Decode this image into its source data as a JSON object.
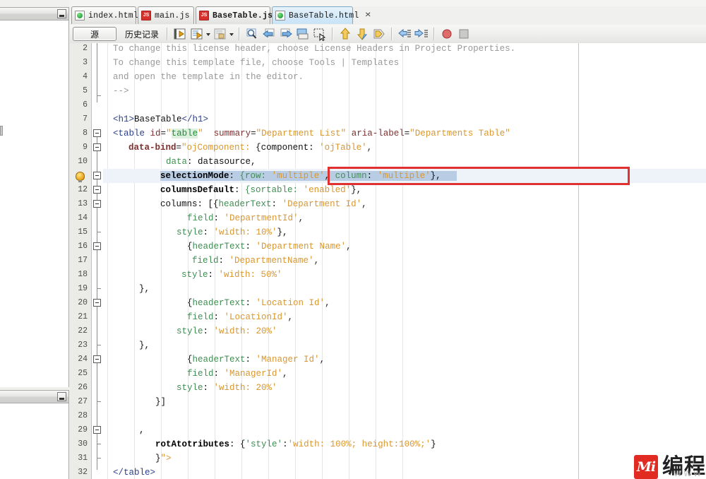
{
  "window": {
    "left_panels": [
      {
        "name": "upper-dock-panel",
        "minimize_label": "minimize"
      },
      {
        "name": "lower-dock-panel",
        "minimize_label": "minimize"
      }
    ]
  },
  "tabs": [
    {
      "label": "index.html",
      "icon": "html-file-icon",
      "active": false,
      "bold": false,
      "close": "✕"
    },
    {
      "label": "main.js",
      "icon": "js-file-icon",
      "active": false,
      "bold": false,
      "close": "✕"
    },
    {
      "label": "BaseTable.js",
      "icon": "js-file-icon",
      "active": false,
      "bold": true,
      "close": "✕"
    },
    {
      "label": "BaseTable.html",
      "icon": "html-file-icon",
      "active": true,
      "bold": false,
      "close": "✕"
    }
  ],
  "toolbar": {
    "source_label": "源",
    "history_label": "历史记录",
    "buttons": [
      "back-to-source-icon",
      "edit-with-dropdown-icon",
      "insert-icon",
      "find-icon",
      "previous-icon",
      "next-icon",
      "toggle-panel-icon",
      "select-region-icon",
      "shift-up-icon",
      "shift-down-icon",
      "tag-icon",
      "shift-left-icon",
      "shift-right-icon",
      "stop-record-icon",
      "stop-icon"
    ]
  },
  "editor": {
    "first_visible_line": 2,
    "last_visible_line": 32,
    "selected_line": 11,
    "bulb_line": 11,
    "lines": [
      {
        "n": 2,
        "indent": 1,
        "tokens": [
          {
            "t": "To change this license header, choose License Headers in Project Properties.",
            "c": "c-comment"
          }
        ]
      },
      {
        "n": 3,
        "indent": 1,
        "tokens": [
          {
            "t": "To change this template file, choose Tools | Templates",
            "c": "c-comment"
          }
        ]
      },
      {
        "n": 4,
        "indent": 1,
        "tokens": [
          {
            "t": "and open the template in the editor.",
            "c": "c-comment"
          }
        ]
      },
      {
        "n": 5,
        "indent": 1,
        "tokens": [
          {
            "t": "-->",
            "c": "c-comment"
          }
        ]
      },
      {
        "n": 6,
        "indent": 0,
        "tokens": []
      },
      {
        "n": 7,
        "indent": 1,
        "tokens": [
          {
            "t": "<h1>",
            "c": "c-tag"
          },
          {
            "t": "BaseTable",
            "c": "c-plain"
          },
          {
            "t": "</h1>",
            "c": "c-tag"
          }
        ]
      },
      {
        "n": 8,
        "indent": 1,
        "tokens": [
          {
            "t": "<table",
            "c": "c-tag"
          },
          {
            "t": " ",
            "c": "c-plain"
          },
          {
            "t": "id",
            "c": "c-attrplain"
          },
          {
            "t": "=",
            "c": "c-punct"
          },
          {
            "t": "\"",
            "c": "c-str"
          },
          {
            "t": "table",
            "c": "c-strhl"
          },
          {
            "t": "\"",
            "c": "c-str"
          },
          {
            "t": "  ",
            "c": "c-plain"
          },
          {
            "t": "summary",
            "c": "c-attrplain"
          },
          {
            "t": "=",
            "c": "c-punct"
          },
          {
            "t": "\"Department List\"",
            "c": "c-str"
          },
          {
            "t": " ",
            "c": "c-plain"
          },
          {
            "t": "aria-label",
            "c": "c-attrplain"
          },
          {
            "t": "=",
            "c": "c-punct"
          },
          {
            "t": "\"Departments Table\"",
            "c": "c-str"
          }
        ]
      },
      {
        "n": 9,
        "indent": 4,
        "tokens": [
          {
            "t": "data-bind",
            "c": "c-attr"
          },
          {
            "t": "=",
            "c": "c-punct"
          },
          {
            "t": "\"ojComponent: ",
            "c": "c-str"
          },
          {
            "t": "{component: ",
            "c": "c-plain"
          },
          {
            "t": "'ojTable'",
            "c": "c-str"
          },
          {
            "t": ",",
            "c": "c-punct"
          }
        ]
      },
      {
        "n": 10,
        "indent": 11,
        "tokens": [
          {
            "t": "data",
            "c": "c-prop"
          },
          {
            "t": ": datasource,",
            "c": "c-plain"
          }
        ]
      },
      {
        "n": 11,
        "indent": 10,
        "tokens": [
          {
            "t": "selectionMode",
            "c": "c-propb"
          },
          {
            "t": ": ",
            "c": "c-plain"
          },
          {
            "t": "{row: ",
            "c": "c-prop"
          },
          {
            "t": "'multiple'",
            "c": "c-str"
          },
          {
            "t": ", ",
            "c": "c-plain"
          },
          {
            "t": "column",
            "c": "c-prop"
          },
          {
            "t": ": ",
            "c": "c-plain"
          },
          {
            "t": "'multiple'",
            "c": "c-str"
          },
          {
            "t": "},",
            "c": "c-plain"
          }
        ]
      },
      {
        "n": 12,
        "indent": 10,
        "tokens": [
          {
            "t": "columnsDefault",
            "c": "c-propb"
          },
          {
            "t": ": ",
            "c": "c-plain"
          },
          {
            "t": "{sortable: ",
            "c": "c-prop"
          },
          {
            "t": "'enabled'",
            "c": "c-str"
          },
          {
            "t": "},",
            "c": "c-plain"
          }
        ]
      },
      {
        "n": 13,
        "indent": 10,
        "tokens": [
          {
            "t": "columns",
            "c": "c-plain"
          },
          {
            "t": ": [{",
            "c": "c-plain"
          },
          {
            "t": "headerText",
            "c": "c-prop"
          },
          {
            "t": ": ",
            "c": "c-plain"
          },
          {
            "t": "'Department Id'",
            "c": "c-str"
          },
          {
            "t": ",",
            "c": "c-punct"
          }
        ]
      },
      {
        "n": 14,
        "indent": 15,
        "tokens": [
          {
            "t": "field",
            "c": "c-prop"
          },
          {
            "t": ": ",
            "c": "c-plain"
          },
          {
            "t": "'DepartmentId'",
            "c": "c-str"
          },
          {
            "t": ",",
            "c": "c-punct"
          }
        ]
      },
      {
        "n": 15,
        "indent": 13,
        "tokens": [
          {
            "t": "style",
            "c": "c-prop"
          },
          {
            "t": ": ",
            "c": "c-plain"
          },
          {
            "t": "'width: 10%'",
            "c": "c-str"
          },
          {
            "t": "},",
            "c": "c-plain"
          }
        ]
      },
      {
        "n": 16,
        "indent": 15,
        "tokens": [
          {
            "t": "{",
            "c": "c-plain"
          },
          {
            "t": "headerText",
            "c": "c-prop"
          },
          {
            "t": ": ",
            "c": "c-plain"
          },
          {
            "t": "'Department Name'",
            "c": "c-str"
          },
          {
            "t": ",",
            "c": "c-punct"
          }
        ]
      },
      {
        "n": 17,
        "indent": 16,
        "tokens": [
          {
            "t": "field",
            "c": "c-prop"
          },
          {
            "t": ": ",
            "c": "c-plain"
          },
          {
            "t": "'DepartmentName'",
            "c": "c-str"
          },
          {
            "t": ",",
            "c": "c-punct"
          }
        ]
      },
      {
        "n": 18,
        "indent": 14,
        "tokens": [
          {
            "t": "style",
            "c": "c-prop"
          },
          {
            "t": ": ",
            "c": "c-plain"
          },
          {
            "t": "'width: 50%'",
            "c": "c-str"
          }
        ]
      },
      {
        "n": 19,
        "indent": 6,
        "tokens": [
          {
            "t": "},",
            "c": "c-plain"
          }
        ]
      },
      {
        "n": 20,
        "indent": 15,
        "tokens": [
          {
            "t": "{",
            "c": "c-plain"
          },
          {
            "t": "headerText",
            "c": "c-prop"
          },
          {
            "t": ": ",
            "c": "c-plain"
          },
          {
            "t": "'Location Id'",
            "c": "c-str"
          },
          {
            "t": ",",
            "c": "c-punct"
          }
        ]
      },
      {
        "n": 21,
        "indent": 15,
        "tokens": [
          {
            "t": "field",
            "c": "c-prop"
          },
          {
            "t": ": ",
            "c": "c-plain"
          },
          {
            "t": "'LocationId'",
            "c": "c-str"
          },
          {
            "t": ",",
            "c": "c-punct"
          }
        ]
      },
      {
        "n": 22,
        "indent": 13,
        "tokens": [
          {
            "t": "style",
            "c": "c-prop"
          },
          {
            "t": ": ",
            "c": "c-plain"
          },
          {
            "t": "'width: 20%'",
            "c": "c-str"
          }
        ]
      },
      {
        "n": 23,
        "indent": 6,
        "tokens": [
          {
            "t": "},",
            "c": "c-plain"
          }
        ]
      },
      {
        "n": 24,
        "indent": 15,
        "tokens": [
          {
            "t": "{",
            "c": "c-plain"
          },
          {
            "t": "headerText",
            "c": "c-prop"
          },
          {
            "t": ": ",
            "c": "c-plain"
          },
          {
            "t": "'Manager Id'",
            "c": "c-str"
          },
          {
            "t": ",",
            "c": "c-punct"
          }
        ]
      },
      {
        "n": 25,
        "indent": 15,
        "tokens": [
          {
            "t": "field",
            "c": "c-prop"
          },
          {
            "t": ": ",
            "c": "c-plain"
          },
          {
            "t": "'ManagerId'",
            "c": "c-str"
          },
          {
            "t": ",",
            "c": "c-punct"
          }
        ]
      },
      {
        "n": 26,
        "indent": 13,
        "tokens": [
          {
            "t": "style",
            "c": "c-prop"
          },
          {
            "t": ": ",
            "c": "c-plain"
          },
          {
            "t": "'width: 20%'",
            "c": "c-str"
          }
        ]
      },
      {
        "n": 27,
        "indent": 9,
        "tokens": [
          {
            "t": "}]",
            "c": "c-plain"
          }
        ]
      },
      {
        "n": 28,
        "indent": 0,
        "tokens": []
      },
      {
        "n": 29,
        "indent": 6,
        "tokens": [
          {
            "t": ",",
            "c": "c-plain"
          }
        ]
      },
      {
        "n": 30,
        "indent": 9,
        "tokens": [
          {
            "t": "rotAtotributes",
            "c": "c-propb"
          },
          {
            "t": ": {",
            "c": "c-plain"
          },
          {
            "t": "'style'",
            "c": "c-prop"
          },
          {
            "t": ":",
            "c": "c-plain"
          },
          {
            "t": "'width: 100%; height:100%;'",
            "c": "c-str"
          },
          {
            "t": "}",
            "c": "c-plain"
          }
        ]
      },
      {
        "n": 31,
        "indent": 9,
        "tokens": [
          {
            "t": "}",
            "c": "c-plain"
          },
          {
            "t": "\">",
            "c": "c-str"
          }
        ]
      },
      {
        "n": 32,
        "indent": 1,
        "tokens": [
          {
            "t": "</table>",
            "c": "c-tag"
          }
        ]
      }
    ]
  },
  "annotation": {
    "type": "red-highlight-rectangle",
    "target_line": 11,
    "color": "#e03030"
  },
  "watermark": {
    "logo_glyph": "Mi",
    "text": "编程",
    "sub": "WWW",
    "logo_color": "#e1251b"
  },
  "colors": {
    "comment": "#999999",
    "tag": "#2b3f8c",
    "attribute": "#7f2f2f",
    "string": "#d99730",
    "property": "#3f8f52",
    "selection": "#b8cce4",
    "selected_line": "#eef3fa",
    "active_tab": "#c9e3f6"
  }
}
